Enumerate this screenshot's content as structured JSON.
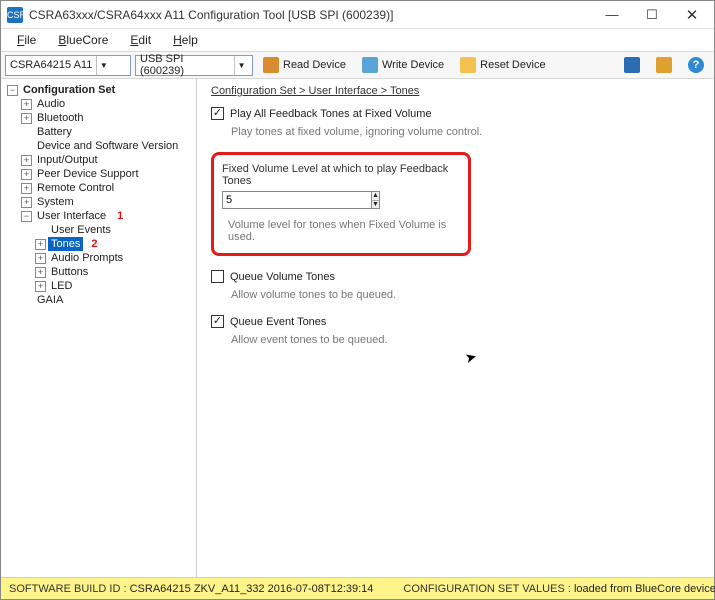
{
  "window": {
    "title": "CSRA63xxx/CSRA64xxx A11 Configuration Tool [USB SPI (600239)]",
    "app_icon_text": "CSR"
  },
  "win_controls": {
    "min": "—",
    "max": "☐",
    "close": "✕"
  },
  "menu": {
    "file": "File",
    "bluecore": "BlueCore",
    "edit": "Edit",
    "help": "Help"
  },
  "toolbar": {
    "device_combo": "CSRA64215 A11",
    "transport_combo": "USB SPI (600239)",
    "read": "Read Device",
    "write": "Write Device",
    "reset": "Reset Device",
    "help_glyph": "?"
  },
  "tree": {
    "root": "Configuration Set",
    "items": {
      "audio": "Audio",
      "bluetooth": "Bluetooth",
      "battery": "Battery",
      "devsw": "Device and Software Version",
      "io": "Input/Output",
      "peer": "Peer Device Support",
      "remote": "Remote Control",
      "system": "System",
      "ui": "User Interface",
      "user_events": "User Events",
      "tones": "Tones",
      "audio_prompts": "Audio Prompts",
      "buttons": "Buttons",
      "led": "LED",
      "gaia": "GAIA"
    },
    "annot1": "1",
    "annot2": "2"
  },
  "breadcrumb": "Configuration Set > User Interface > Tones",
  "opt_play_all": {
    "label": "Play All Feedback Tones at Fixed Volume",
    "checked": true,
    "desc": "Play tones at fixed volume, ignoring volume control."
  },
  "fixed_volume": {
    "label": "Fixed Volume Level at which to play Feedback Tones",
    "value": "5",
    "desc": "Volume level for tones when Fixed Volume is used."
  },
  "opt_queue_volume": {
    "label": "Queue Volume Tones",
    "checked": false,
    "desc": "Allow volume tones to be queued."
  },
  "opt_queue_event": {
    "label": "Queue Event Tones",
    "checked": true,
    "desc": "Allow event tones to be queued."
  },
  "status": {
    "build_key": "SOFTWARE BUILD ID :",
    "build_val": "CSRA64215 ZKV_A11_332 2016-07-08T12:39:14",
    "cfg_key": "CONFIGURATION SET VALUES :",
    "cfg_val": "loaded from BlueCore device"
  }
}
